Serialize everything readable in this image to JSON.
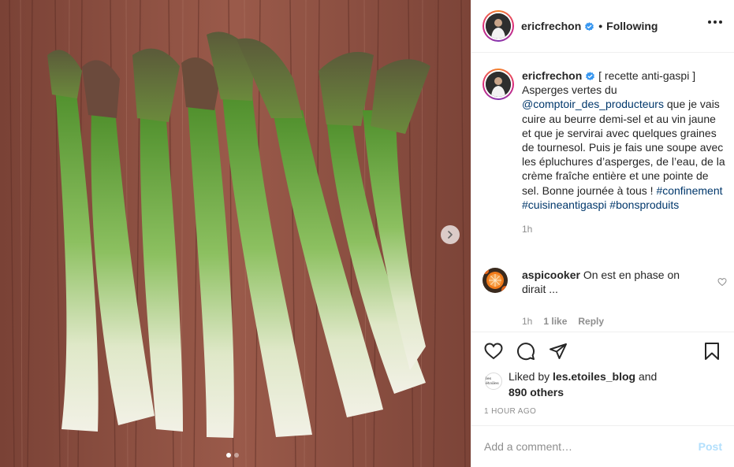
{
  "post": {
    "username": "ericfrechon",
    "separator": "•",
    "follow_status": "Following"
  },
  "caption": {
    "username": "ericfrechon",
    "text_part1": " [ recette anti-gaspi ] Asperges vertes du ",
    "mention": "@comptoir_des_producteurs",
    "text_part2": " que je vais cuire au beurre demi-sel et au vin jaune et que je servirai avec quelques graines de tournesol. Puis je fais une soupe avec les épluchures d’asperges, de l’eau, de la crème fraîche entière et une pointe de sel. Bonne journée à tous ! ",
    "hashtags": [
      "#confinement",
      "#cuisineantigaspi",
      "#bonsproduits"
    ],
    "time": "1h"
  },
  "comments": [
    {
      "username": "aspicooker",
      "text": " On est en phase on dirait ...",
      "time": "1h",
      "likes": "1 like",
      "reply_label": "Reply"
    }
  ],
  "likes": {
    "avatar_text": "les étoiles",
    "prefix": "Liked by ",
    "user": "les.etoiles_blog",
    "middle": " and",
    "others": "890 others"
  },
  "time_ago": "1 hour ago",
  "comment_box": {
    "placeholder": "Add a comment…",
    "post_label": "Post"
  },
  "carousel": {
    "slide_count": 2,
    "active_index": 0
  },
  "colors": {
    "verified": "#3897f0",
    "link": "#00376b",
    "post_disabled": "#b2dffc",
    "wood": "#8a4e3f"
  },
  "icons": {
    "more": "more-options-icon",
    "verified": "verified-badge-icon",
    "next": "chevron-right-icon",
    "like": "heart-icon",
    "comment": "comment-icon",
    "share": "share-icon",
    "save": "bookmark-icon"
  }
}
